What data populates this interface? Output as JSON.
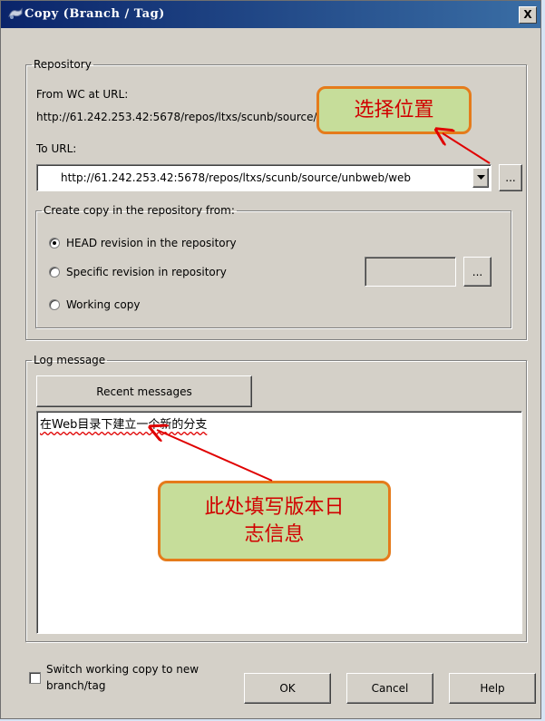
{
  "window": {
    "title": "Copy (Branch / Tag)",
    "close_label": "X"
  },
  "repository": {
    "legend": "Repository",
    "from_wc_label": "From WC at URL:",
    "from_url": "http://61.242.253.42:5678/repos/ltxs/scunb/source/unbweb/web",
    "to_url_label": "To URL:",
    "to_url_value": "http://61.242.253.42:5678/repos/ltxs/scunb/source/unbweb/web",
    "browse_label": "...",
    "dropdown_icon": "chevron-down-icon"
  },
  "copy_from": {
    "legend": "Create copy in the repository from:",
    "options": [
      {
        "label": "HEAD revision in the repository",
        "selected": true
      },
      {
        "label": "Specific revision in repository",
        "selected": false
      },
      {
        "label": "Working copy",
        "selected": false
      }
    ],
    "revision_value": "",
    "revision_browse_label": "..."
  },
  "log": {
    "legend": "Log message",
    "recent_label": "Recent messages",
    "message": "在Web目录下建立一个新的分支"
  },
  "footer": {
    "switch_label_line1": "Switch working copy to new",
    "switch_label_line2": "branch/tag",
    "switch_checked": false,
    "ok_label": "OK",
    "cancel_label": "Cancel",
    "help_label": "Help"
  },
  "annotations": {
    "select_location": "选择位置",
    "log_info": "此处填写版本日志信息",
    "callout_color": "#c6dd9a",
    "border_color": "#e57b1b",
    "arrow_color": "#e00000"
  }
}
